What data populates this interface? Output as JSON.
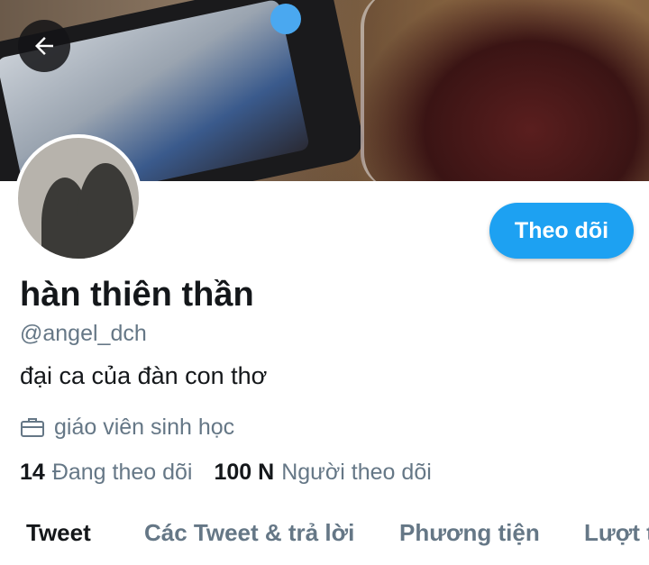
{
  "header": {
    "back_icon": "arrow-left-icon"
  },
  "profile": {
    "display_name": "hàn thiên thần",
    "handle": "@angel_dch",
    "bio": "đại ca của đàn con thơ",
    "occupation_icon": "briefcase-icon",
    "occupation": "giáo viên sinh học",
    "following_count": "14",
    "following_label": "Đang theo dõi",
    "followers_count": "100 N",
    "followers_label": "Người theo dõi"
  },
  "actions": {
    "follow_label": "Theo dõi"
  },
  "tabs": [
    {
      "label": "Tweet",
      "active": true
    },
    {
      "label": "Các Tweet & trả lời",
      "active": false
    },
    {
      "label": "Phương tiện",
      "active": false
    },
    {
      "label": "Lượt thích",
      "active": false
    }
  ],
  "colors": {
    "accent": "#1da1f2",
    "text_primary": "#14171a",
    "text_secondary": "#657786"
  }
}
